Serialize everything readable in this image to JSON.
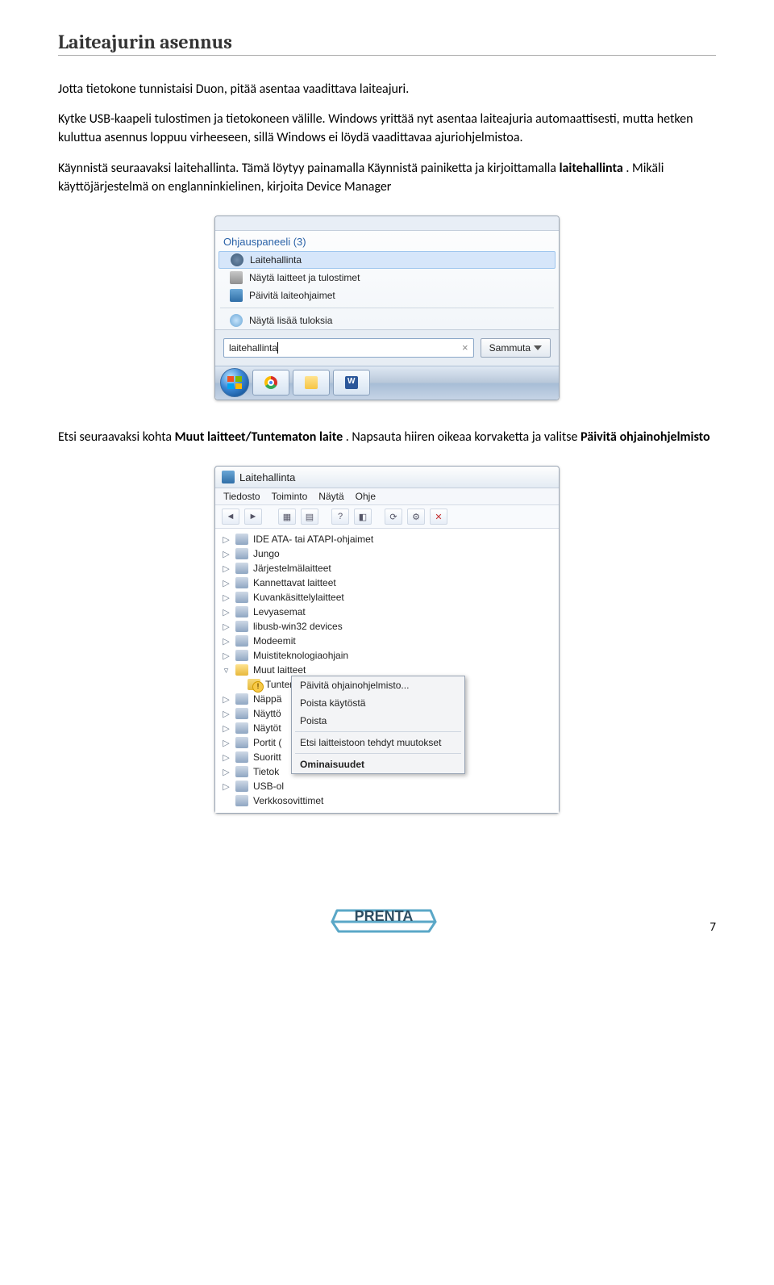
{
  "heading": "Laiteajurin asennus",
  "para1": "Jotta tietokone tunnistaisi Duon, pitää asentaa vaadittava laiteajuri.",
  "para2_a": "Kytke USB-kaapeli tulostimen ja tietokoneen välille. Windows yrittää nyt asentaa laiteajuria automaattisesti, mutta hetken kuluttua asennus loppuu virheeseen, sillä Windows ei löydä vaadittavaa ajuriohjelmistoa.",
  "para3_a": "Käynnistä seuraavaksi laitehallinta. Tämä löytyy painamalla Käynnistä painiketta ja kirjoittamalla ",
  "para3_b": "laitehallinta",
  "para3_c": ". Mikäli käyttöjärjestelmä on englanninkielinen, kirjoita Device Manager",
  "startmenu": {
    "section": "Ohjauspaneeli (3)",
    "items": [
      "Laitehallinta",
      "Näytä laitteet ja tulostimet",
      "Päivitä laiteohjaimet"
    ],
    "more": "Näytä lisää tuloksia",
    "search_value": "laitehallinta",
    "shutdown": "Sammuta"
  },
  "para4_a": "Etsi seuraavaksi kohta ",
  "para4_b": "Muut laitteet/Tuntematon laite",
  "para4_c": ". Napsauta hiiren oikeaa korvaketta ja valitse ",
  "para4_d": "Päivitä ohjainohjelmisto",
  "devmgr": {
    "title": "Laitehallinta",
    "menus": [
      "Tiedosto",
      "Toiminto",
      "Näytä",
      "Ohje"
    ],
    "tree": [
      "IDE ATA- tai ATAPI-ohjaimet",
      "Jungo",
      "Järjestelmälaitteet",
      "Kannettavat laitteet",
      "Kuvankäsittelylaitteet",
      "Levyasemat",
      "libusb-win32 devices",
      "Modeemit",
      "Muistiteknologiaohjain",
      "Muut laitteet",
      "Tuntematon laite",
      "Näppä",
      "Näyttö",
      "Näytöt",
      "Portit (",
      "Suoritt",
      "Tietok",
      "USB-ol",
      "Verkkosovittimet"
    ],
    "contextmenu": [
      "Päivitä ohjainohjelmisto...",
      "Poista käytöstä",
      "Poista",
      "Etsi laitteistoon tehdyt muutokset",
      "Ominaisuudet"
    ]
  },
  "logo_text": "PRENTA",
  "pagenum": "7"
}
